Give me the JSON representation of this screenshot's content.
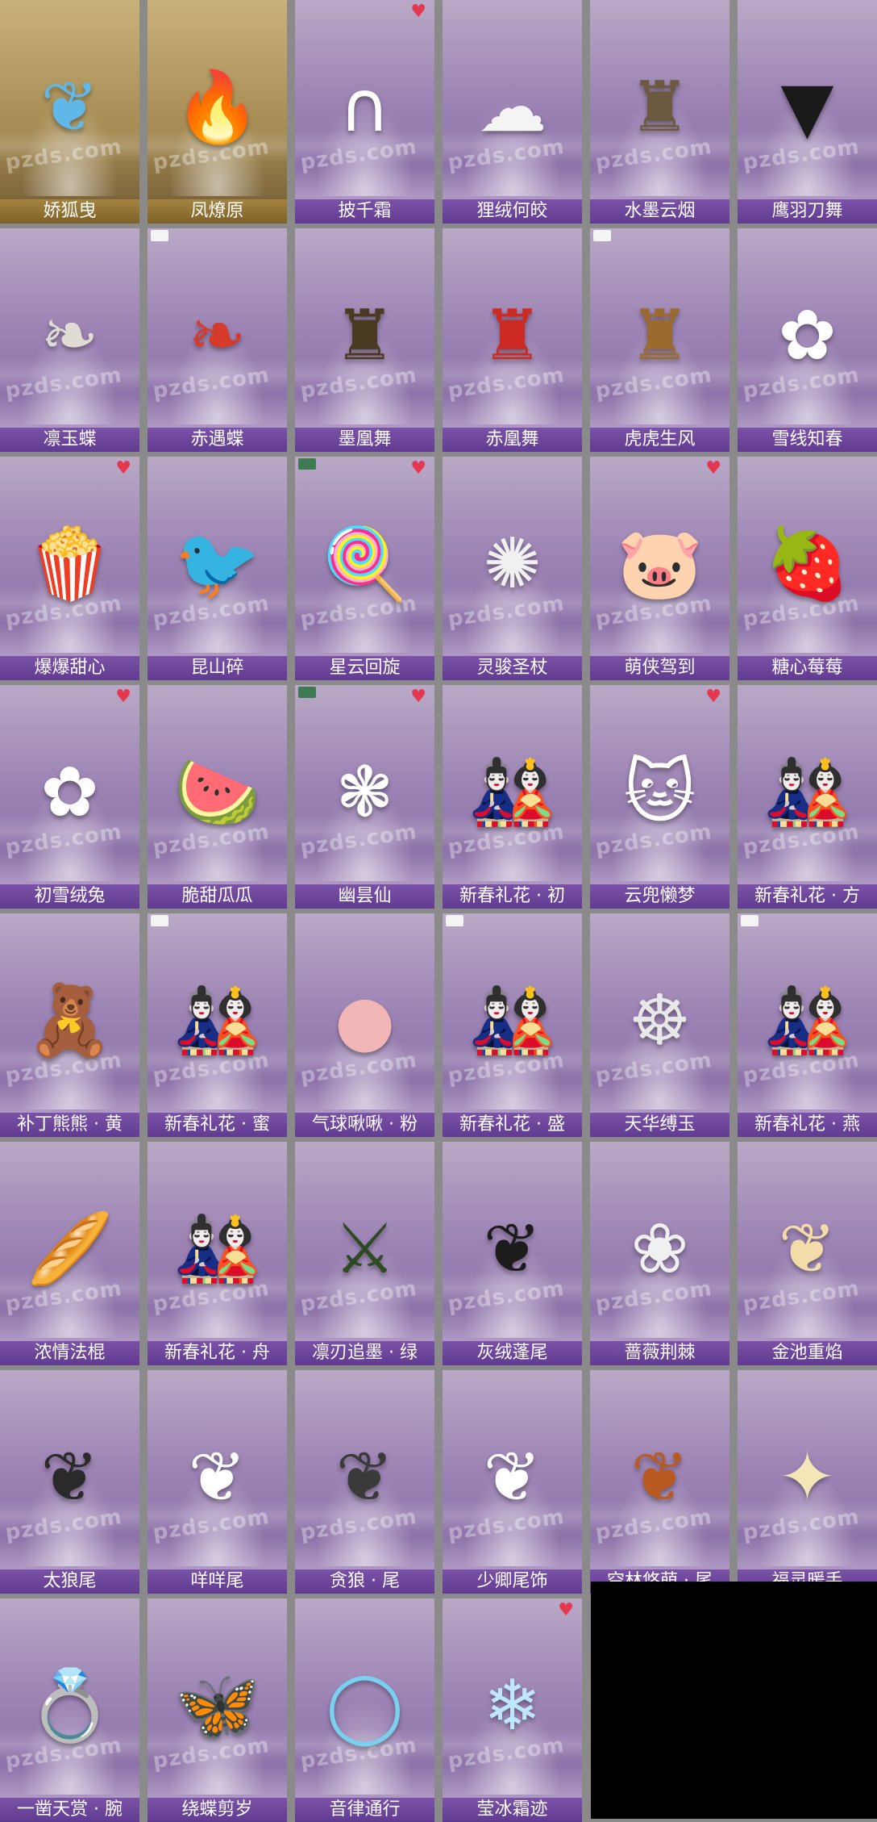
{
  "watermark": "pzds.com",
  "heart_icon": "♥",
  "rows": [
    [
      {
        "label": "娇狐曳",
        "bg": "gold",
        "icon": "tail-icon",
        "art": "❦",
        "art_color": "#5fb8e8"
      },
      {
        "label": "凤燎原",
        "bg": "gold",
        "icon": "flame-icon",
        "art": "🔥",
        "art_color": "#ff6a1a"
      },
      {
        "label": "披千霜",
        "bg": "purple",
        "icon": "fur-collar-icon",
        "art": "∩",
        "art_color": "#ffffff",
        "heart": true
      },
      {
        "label": "狸绒何皎",
        "bg": "purple",
        "icon": "hair-icon",
        "art": "☁",
        "art_color": "#f4f4f4"
      },
      {
        "label": "水墨云烟",
        "bg": "purple",
        "icon": "robe-icon",
        "art": "♜",
        "art_color": "#6b5a40"
      },
      {
        "label": "鹰羽刀舞",
        "bg": "purple",
        "icon": "cape-icon",
        "art": "▼",
        "art_color": "#1a1a1a"
      }
    ],
    [
      {
        "label": "凛玉蝶",
        "bg": "purple",
        "icon": "cape-icon",
        "art": "❧",
        "art_color": "#e0dcd4"
      },
      {
        "label": "赤遇蝶",
        "bg": "purple",
        "icon": "cape-icon",
        "art": "❧",
        "art_color": "#d63a2a",
        "badge": "new"
      },
      {
        "label": "墨凰舞",
        "bg": "purple",
        "icon": "robe-icon",
        "art": "♜",
        "art_color": "#4a3a22"
      },
      {
        "label": "赤凰舞",
        "bg": "purple",
        "icon": "robe-icon",
        "art": "♜",
        "art_color": "#cc2a22"
      },
      {
        "label": "虎虎生风",
        "bg": "purple",
        "icon": "tiger-robe-icon",
        "art": "♜",
        "art_color": "#9a6a2e",
        "badge": "new"
      },
      {
        "label": "雪线知春",
        "bg": "purple",
        "icon": "rabbit-icon",
        "art": "✿",
        "art_color": "#ffffff"
      }
    ],
    [
      {
        "label": "爆爆甜心",
        "bg": "purple",
        "icon": "popcorn-icon",
        "art": "🍿",
        "art_color": "#d8232a",
        "heart": true
      },
      {
        "label": "昆山碎",
        "bg": "purple",
        "icon": "bird-icon",
        "art": "🐦",
        "art_color": "#2a9a8a"
      },
      {
        "label": "星云回旋",
        "bg": "purple",
        "icon": "lollipop-icon",
        "art": "🍭",
        "art_color": "#b06ad8",
        "heart": true,
        "badge": "green"
      },
      {
        "label": "灵骏圣杖",
        "bg": "purple",
        "icon": "staff-icon",
        "art": "✺",
        "art_color": "#f0f0f0"
      },
      {
        "label": "萌侠驾到",
        "bg": "purple",
        "icon": "pig-icon",
        "art": "🐷",
        "art_color": "#e02222",
        "heart": true
      },
      {
        "label": "糖心莓莓",
        "bg": "purple",
        "icon": "strawberry-icon",
        "art": "🍓",
        "art_color": "#e02a3a"
      }
    ],
    [
      {
        "label": "初雪绒兔",
        "bg": "purple",
        "icon": "rabbit-icon",
        "art": "✿",
        "art_color": "#ffffff",
        "heart": true
      },
      {
        "label": "脆甜瓜瓜",
        "bg": "purple",
        "icon": "watermelon-icon",
        "art": "🍉",
        "art_color": "#e04848"
      },
      {
        "label": "幽昙仙",
        "bg": "purple",
        "icon": "wings-icon",
        "art": "❃",
        "art_color": "#ffffff",
        "heart": true,
        "badge": "green"
      },
      {
        "label": "新春礼花 · 初",
        "bg": "purple",
        "icon": "chibi-icon",
        "art": "🎎",
        "art_color": "#cc2a2a"
      },
      {
        "label": "云兜懒梦",
        "bg": "purple",
        "icon": "cat-bag-icon",
        "art": "🐱",
        "art_color": "#ffffff",
        "heart": true
      },
      {
        "label": "新春礼花 · 方",
        "bg": "purple",
        "icon": "chibi-icon",
        "art": "🎎",
        "art_color": "#cc2a2a"
      }
    ],
    [
      {
        "label": "补丁熊熊 · 黄",
        "bg": "purple",
        "icon": "teddy-bear-icon",
        "art": "🧸",
        "art_color": "#e8c84a"
      },
      {
        "label": "新春礼花 · 蜜",
        "bg": "purple",
        "icon": "chibi-icon",
        "art": "🎎",
        "art_color": "#cc2a2a",
        "badge": "new"
      },
      {
        "label": "气球啾啾 · 粉",
        "bg": "purple",
        "icon": "balloon-icon",
        "art": "●",
        "art_color": "#f2b6b6"
      },
      {
        "label": "新春礼花 · 盛",
        "bg": "purple",
        "icon": "chibi-icon",
        "art": "🎎",
        "art_color": "#cc2a2a",
        "badge": "new"
      },
      {
        "label": "天华缚玉",
        "bg": "purple",
        "icon": "pendant-icon",
        "art": "☸",
        "art_color": "#e8e8e8"
      },
      {
        "label": "新春礼花 · 燕",
        "bg": "purple",
        "icon": "chibi-icon",
        "art": "🎎",
        "art_color": "#cc2a2a",
        "badge": "new"
      }
    ],
    [
      {
        "label": "浓情法棍",
        "bg": "purple",
        "icon": "baguette-icon",
        "art": "🥖",
        "art_color": "#d8a860"
      },
      {
        "label": "新春礼花 · 舟",
        "bg": "purple",
        "icon": "chibi-icon",
        "art": "🎎",
        "art_color": "#cc2a2a"
      },
      {
        "label": "凛刃追墨 · 绿",
        "bg": "purple",
        "icon": "sword-icon",
        "art": "⚔",
        "art_color": "#2e4a22"
      },
      {
        "label": "灰绒蓬尾",
        "bg": "purple",
        "icon": "tail-icon",
        "art": "❦",
        "art_color": "#1c1c1c"
      },
      {
        "label": "蔷薇荆棘",
        "bg": "purple",
        "icon": "thorn-icon",
        "art": "❀",
        "art_color": "#f0f0f0"
      },
      {
        "label": "金池重焰",
        "bg": "purple",
        "icon": "tail-icon",
        "art": "❦",
        "art_color": "#f4dca8"
      }
    ],
    [
      {
        "label": "太狼尾",
        "bg": "purple",
        "icon": "tail-icon",
        "art": "❦",
        "art_color": "#2a2a2a"
      },
      {
        "label": "咩咩尾",
        "bg": "purple",
        "icon": "tail-icon",
        "art": "❦",
        "art_color": "#ffffff"
      },
      {
        "label": "贪狼 · 尾",
        "bg": "purple",
        "icon": "tail-icon",
        "art": "❦",
        "art_color": "#3a3a3a"
      },
      {
        "label": "少卿尾饰",
        "bg": "purple",
        "icon": "tail-icon",
        "art": "❦",
        "art_color": "#ffffff"
      },
      {
        "label": "空林悠萌 · 尾",
        "bg": "purple",
        "icon": "tail-icon",
        "art": "❦",
        "art_color": "#b85a22"
      },
      {
        "label": "福灵暖手",
        "bg": "purple",
        "icon": "hand-warmer-icon",
        "art": "✦",
        "art_color": "#f4e6b6"
      }
    ],
    [
      {
        "label": "一凿天赏 · 腕",
        "bg": "purple",
        "icon": "ring-icon",
        "art": "💍",
        "art_color": "#2ac05a"
      },
      {
        "label": "绕蝶剪岁",
        "bg": "purple",
        "icon": "butterfly-icon",
        "art": "🦋",
        "art_color": "#d8202a"
      },
      {
        "label": "音律通行",
        "bg": "purple",
        "icon": "bracelet-icon",
        "art": "◯",
        "art_color": "#7ad0f0"
      },
      {
        "label": "莹冰霜迹",
        "bg": "purple",
        "icon": "ice-icon",
        "art": "❄",
        "art_color": "#bfe6ff",
        "heart": true
      }
    ]
  ]
}
